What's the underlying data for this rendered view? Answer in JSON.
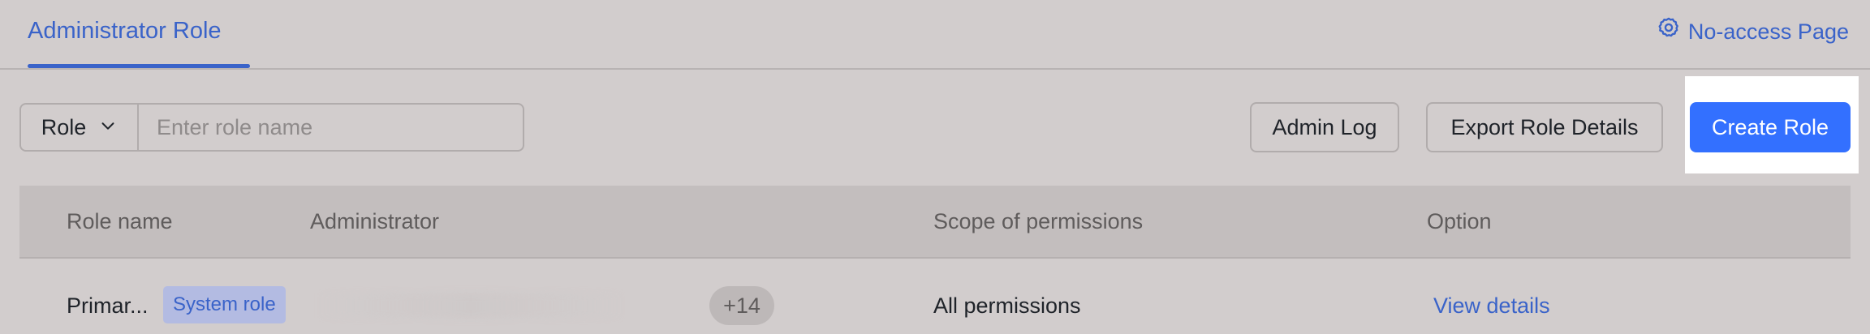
{
  "header": {
    "active_tab": "Administrator Role",
    "no_access_link": "No-access Page",
    "no_access_icon": "gear-icon"
  },
  "toolbar": {
    "role_select_value": "Role",
    "search_placeholder": "Enter role name",
    "admin_log_label": "Admin Log",
    "export_label": "Export Role Details",
    "create_label": "Create Role"
  },
  "table": {
    "columns": [
      "Role name",
      "Administrator",
      "Scope of permissions",
      "Option"
    ],
    "rows": [
      {
        "role_name": "Primar...",
        "badge": "System role",
        "admin_more_count": "+14",
        "scope": "All permissions",
        "option": "View details"
      }
    ]
  },
  "colors": {
    "accent": "#3370ff",
    "link": "#3a63c9",
    "background": "#d2cdcd"
  }
}
